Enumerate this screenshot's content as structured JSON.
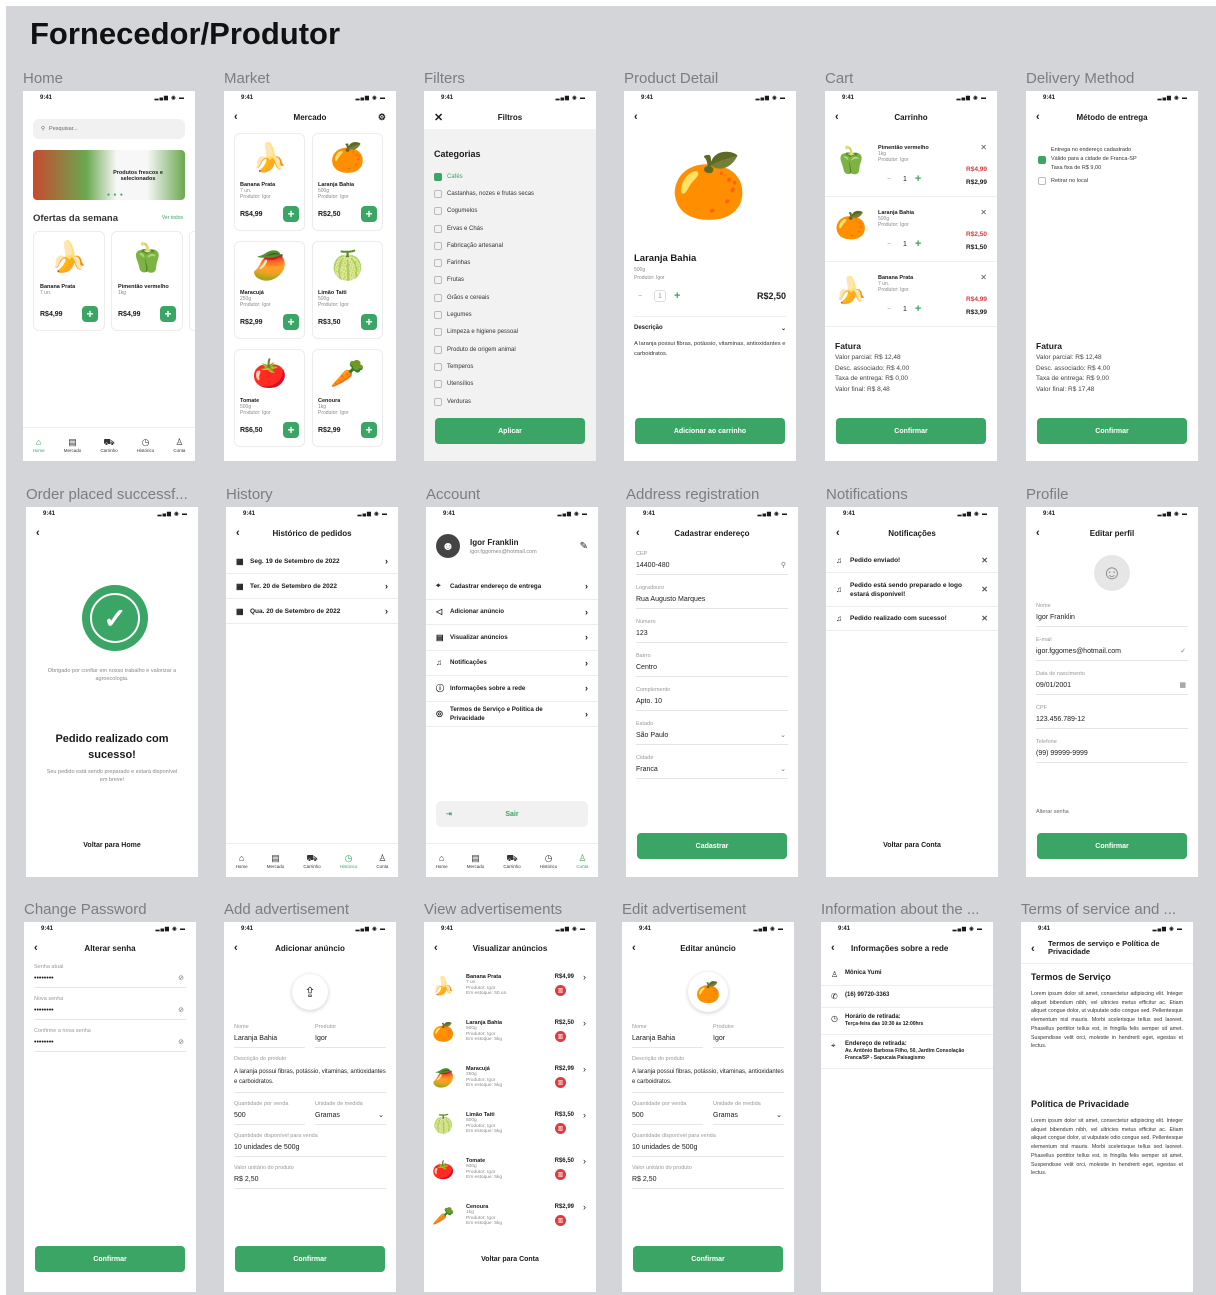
{
  "board": {
    "title": "Fornecedor/Produtor"
  },
  "frames": [
    "Home",
    "Market",
    "Filters",
    "Product Detail",
    "Cart",
    "Delivery Method",
    "Order placed successf...",
    "History",
    "Account",
    "Address registration",
    "Notifications",
    "Profile",
    "Change Password",
    "Add advertisement",
    "View advertisements",
    "Edit advertisement",
    "Information about the ...",
    "Terms of service and ..."
  ],
  "colors": {
    "accent": "#3aa564",
    "danger": "#e0393e",
    "board_bg": "#d4d5d9"
  },
  "common": {
    "time": "9:41",
    "tabs": [
      "Home",
      "Mercado",
      "Carrinho",
      "Histórico",
      "Conta"
    ],
    "confirm": "Confirmar"
  },
  "home": {
    "search_placeholder": "Pesquisar...",
    "banner_text": "Produtos frescos e selecionados",
    "section_title": "Ofertas da semana",
    "see_all": "Ver todos",
    "offers": [
      {
        "name": "Banana Prata",
        "unit": "7 un.",
        "price": "R$4,99"
      },
      {
        "name": "Pimentão vermelho",
        "unit": "1kg",
        "price": "R$4,99"
      }
    ]
  },
  "market": {
    "title": "Mercado",
    "items": [
      {
        "name": "Banana Prata",
        "unit": "7 un.",
        "producer": "Produtor: Igor",
        "price": "R$4,99"
      },
      {
        "name": "Laranja Bahia",
        "unit": "500g",
        "producer": "Produtor: Igor",
        "price": "R$2,50"
      },
      {
        "name": "Maracujá",
        "unit": "250g",
        "producer": "Produtor: Igor",
        "price": "R$2,99"
      },
      {
        "name": "Limão Taiti",
        "unit": "500g",
        "producer": "Produtor: Igor",
        "price": "R$3,50"
      },
      {
        "name": "Tomate",
        "unit": "500g",
        "producer": "Produtor: Igor",
        "price": "R$6,50"
      },
      {
        "name": "Cenoura",
        "unit": "1kg",
        "producer": "Produtor: Igor",
        "price": "R$2,99"
      }
    ]
  },
  "filters": {
    "title": "Filtros",
    "section": "Categorias",
    "categories": [
      {
        "label": "Cafés",
        "checked": true
      },
      {
        "label": "Castanhas, nozes e frutas secas",
        "checked": false
      },
      {
        "label": "Cogumelos",
        "checked": false
      },
      {
        "label": "Ervas e Chás",
        "checked": false
      },
      {
        "label": "Fabricação artesanal",
        "checked": false
      },
      {
        "label": "Farinhas",
        "checked": false
      },
      {
        "label": "Frutas",
        "checked": false
      },
      {
        "label": "Grãos e cereais",
        "checked": false
      },
      {
        "label": "Legumes",
        "checked": false
      },
      {
        "label": "Limpeza e higiene pessoal",
        "checked": false
      },
      {
        "label": "Produto de origem animal",
        "checked": false
      },
      {
        "label": "Temperos",
        "checked": false
      },
      {
        "label": "Utensílios",
        "checked": false
      },
      {
        "label": "Verduras",
        "checked": false
      }
    ],
    "apply": "Aplicar"
  },
  "detail": {
    "name": "Laranja Bahia",
    "unit": "500g",
    "producer": "Produtor: Igor",
    "qty": "1",
    "price": "R$2,50",
    "desc_label": "Descrição",
    "desc": "A laranja possui fibras, potássio, vitaminas, antioxidantes e carboidratos.",
    "cta": "Adicionar ao carrinho"
  },
  "cart": {
    "title": "Carrinho",
    "items": [
      {
        "name": "Pimentão vermelho",
        "unit": "1kg",
        "producer": "Produtor: Igor",
        "qty": "1",
        "old": "R$4,99",
        "new": "R$2,99"
      },
      {
        "name": "Laranja Bahia",
        "unit": "500g",
        "producer": "Produtor: Igor",
        "qty": "1",
        "old": "R$2,50",
        "new": "R$1,50"
      },
      {
        "name": "Banana Prata",
        "unit": "7 un.",
        "producer": "Produtor: Igor",
        "qty": "1",
        "old": "R$4,99",
        "new": "R$3,99"
      }
    ],
    "invoice": {
      "title": "Fatura",
      "lines": [
        "Valor parcial: R$ 12,48",
        "Desc. associado: R$ 4,00",
        "Taxa de entrega: R$ 0,00",
        "Valor final: R$ 8,48"
      ]
    }
  },
  "delivery": {
    "title": "Método de entrega",
    "opt1": [
      "Entrega no endereço cadastrado",
      "Válido para a cidade de Franca-SP",
      "Taxa fixa de R$ 9,00"
    ],
    "opt2": "Retirar no local",
    "invoice": {
      "title": "Fatura",
      "lines": [
        "Valor parcial: R$ 12,48",
        "Desc. associado: R$ 4,00",
        "Taxa de entrega: R$ 9,00",
        "Valor final: R$ 17,48"
      ]
    }
  },
  "order": {
    "thanks": "Obrigado por confiar em nosso trabalho e valorizar a agroecologia.",
    "title": "Pedido realizado com sucesso!",
    "sub": "Seu pedido está sendo preparado e estará disponível em breve!",
    "back": "Voltar para Home"
  },
  "history": {
    "title": "Histórico de pedidos",
    "rows": [
      "Seg. 19 de Setembro de 2022",
      "Ter. 20 de Setembro de 2022",
      "Qua. 20 de Setembro de 2022"
    ]
  },
  "account": {
    "name": "Igor Franklin",
    "email": "igor.fggomes@hotmail.com",
    "menu": [
      {
        "icon": "location-icon",
        "glyph": "⌖",
        "label": "Cadastrar endereço de entrega"
      },
      {
        "icon": "megaphone-icon",
        "glyph": "◁",
        "label": "Adicionar anúncio"
      },
      {
        "icon": "list-icon",
        "glyph": "▤",
        "label": "Visualizar anúncios"
      },
      {
        "icon": "bell-icon",
        "glyph": "♫",
        "label": "Notificações"
      },
      {
        "icon": "info-icon",
        "glyph": "ⓘ",
        "label": "Informações sobre a rede"
      },
      {
        "icon": "shield-icon",
        "glyph": "◎",
        "label": "Termos de Serviço e Política de Privacidade"
      }
    ],
    "logout": "Sair"
  },
  "address": {
    "title": "Cadastrar endereço",
    "fields": [
      {
        "label": "CEP",
        "value": "14400-480",
        "icon": "search-icon",
        "glyph": "⚲"
      },
      {
        "label": "Logradouro",
        "value": "Rua Augusto Marques"
      },
      {
        "label": "Número",
        "value": "123"
      },
      {
        "label": "Bairro",
        "value": "Centro"
      },
      {
        "label": "Complemento",
        "value": "Apto. 10"
      },
      {
        "label": "Estado",
        "value": "São Paulo",
        "icon": "chevron-down-icon",
        "glyph": "⌄"
      },
      {
        "label": "Cidade",
        "value": "Franca",
        "icon": "chevron-down-icon",
        "glyph": "⌄"
      }
    ],
    "submit": "Cadastrar"
  },
  "notif": {
    "title": "Notificações",
    "items": [
      "Pedido enviado!",
      "Pedido está sendo preparado e logo estará disponível!",
      "Pedido realizado com sucesso!"
    ],
    "back": "Voltar para Conta"
  },
  "profile": {
    "title": "Editar perfil",
    "fields": [
      {
        "label": "Nome",
        "value": "Igor Franklin"
      },
      {
        "label": "E-mail",
        "value": "igor.fggomes@hotmail.com",
        "icon": "check-icon",
        "glyph": "✓"
      },
      {
        "label": "Data de nascimento",
        "value": "09/01/2001",
        "icon": "calendar-icon",
        "glyph": "▦"
      },
      {
        "label": "CPF",
        "value": "123.456.789-12"
      },
      {
        "label": "Telefone",
        "value": "(99) 99999-9999"
      }
    ],
    "change_pw": "Alterar senha"
  },
  "password": {
    "title": "Alterar senha",
    "fields": [
      {
        "label": "Senha atual",
        "value": "••••••••",
        "icon": "eye-off-icon",
        "glyph": "⊘"
      },
      {
        "label": "Nova senha",
        "value": "••••••••",
        "icon": "eye-off-icon",
        "glyph": "⊘"
      },
      {
        "label": "Confirme a nova senha",
        "value": "••••••••",
        "icon": "eye-off-icon",
        "glyph": "⊘"
      }
    ]
  },
  "addad": {
    "title": "Adicionar anúncio",
    "name_label": "Nome",
    "name": "Laranja Bahia",
    "producer_label": "Produtor",
    "producer": "Igor",
    "desc_label": "Descrição do produto",
    "desc": "A laranja possui fibras, potássio, vitaminas, antioxidantes e carboidratos.",
    "qty_label": "Quantidade por venda",
    "qty": "500",
    "unit_label": "Unidade de medida",
    "unit": "Gramas",
    "stock_label": "Quantidade disponível para venda",
    "stock": "10 unidades de 500g",
    "price_label": "Valor unitário do produto",
    "price": "R$ 2,50"
  },
  "editad": {
    "title": "Editar anúncio",
    "name_label": "Nome",
    "name": "Laranja Bahia",
    "producer_label": "Produtor",
    "producer": "Igor",
    "desc_label": "Descrição do produto",
    "desc": "A laranja possui fibras, potássio, vitaminas, antioxidantes e carboidratos.",
    "qty_label": "Quantidade por venda",
    "qty": "500",
    "unit_label": "Unidade de medida",
    "unit": "Gramas",
    "stock_label": "Quantidade disponível para venda",
    "stock": "10 unidades de 500g",
    "price_label": "Valor unitário do produto",
    "price": "R$ 2,50"
  },
  "viewads": {
    "title": "Visualizar anúncios",
    "items": [
      {
        "emoji": "🍌",
        "name": "Banana Prata",
        "unit": "7 un.",
        "producer": "Produtor: Igor",
        "stock": "Em estoque: 50 un.",
        "price": "R$4,99"
      },
      {
        "emoji": "🍊",
        "name": "Laranja Bahia",
        "unit": "500g",
        "producer": "Produtor: Igor",
        "stock": "Em estoque: 5kg",
        "price": "R$2,50"
      },
      {
        "emoji": "🥭",
        "name": "Maracujá",
        "unit": "250g",
        "producer": "Produtor: Igor",
        "stock": "Em estoque: 5kg",
        "price": "R$2,99"
      },
      {
        "emoji": "🍈",
        "name": "Limão Taiti",
        "unit": "500g",
        "producer": "Produtor: Igor",
        "stock": "Em estoque: 5kg",
        "price": "R$3,50"
      },
      {
        "emoji": "🍅",
        "name": "Tomate",
        "unit": "500g",
        "producer": "Produtor: Igor",
        "stock": "Em estoque: 5kg",
        "price": "R$6,50"
      },
      {
        "emoji": "🥕",
        "name": "Cenoura",
        "unit": "1kg",
        "producer": "Produtor: Igor",
        "stock": "Em estoque: 5kg",
        "price": "R$2,99"
      }
    ],
    "back": "Voltar para Conta"
  },
  "info": {
    "title": "Informações sobre a rede",
    "items": [
      {
        "icon": "user-icon",
        "glyph": "♙",
        "title": "Mônica Yumi",
        "detail": ""
      },
      {
        "icon": "phone-icon",
        "glyph": "✆",
        "title": "(16) 99720-3363",
        "detail": ""
      },
      {
        "icon": "clock-icon",
        "glyph": "◷",
        "title": "Horário de retirada:",
        "detail": "Terça-feira das 10:30 às 12:00hrs"
      },
      {
        "icon": "location-icon",
        "glyph": "⌖",
        "title": "Endereço de retirada:",
        "detail": "Av. Antônio Barbosa Filho, 50, Jardim Consolação Franca/SP - Sapucaia Paisagismo"
      }
    ]
  },
  "terms": {
    "title": "Termos de serviço e Política de Privacidade",
    "h1": "Termos de Serviço",
    "h2": "Política de Privacidade",
    "lorem": "Lorem ipsum dolor sit amet, consectetur adipiscing elit. Integer aliquet bibendum nibh, vel ultricies metus efficitur ac. Etiam aliquet congue dolor, ut vulputate odio congue sed. Pellentesque elementum nisl mauris. Morbi scelerisque tellus sed laoreet. Phasellus porttitor tellus est, in fringilla felis semper sit amet. Suspendisse velit orci, molestie in hendrerit eget, egestas et lectus."
  }
}
